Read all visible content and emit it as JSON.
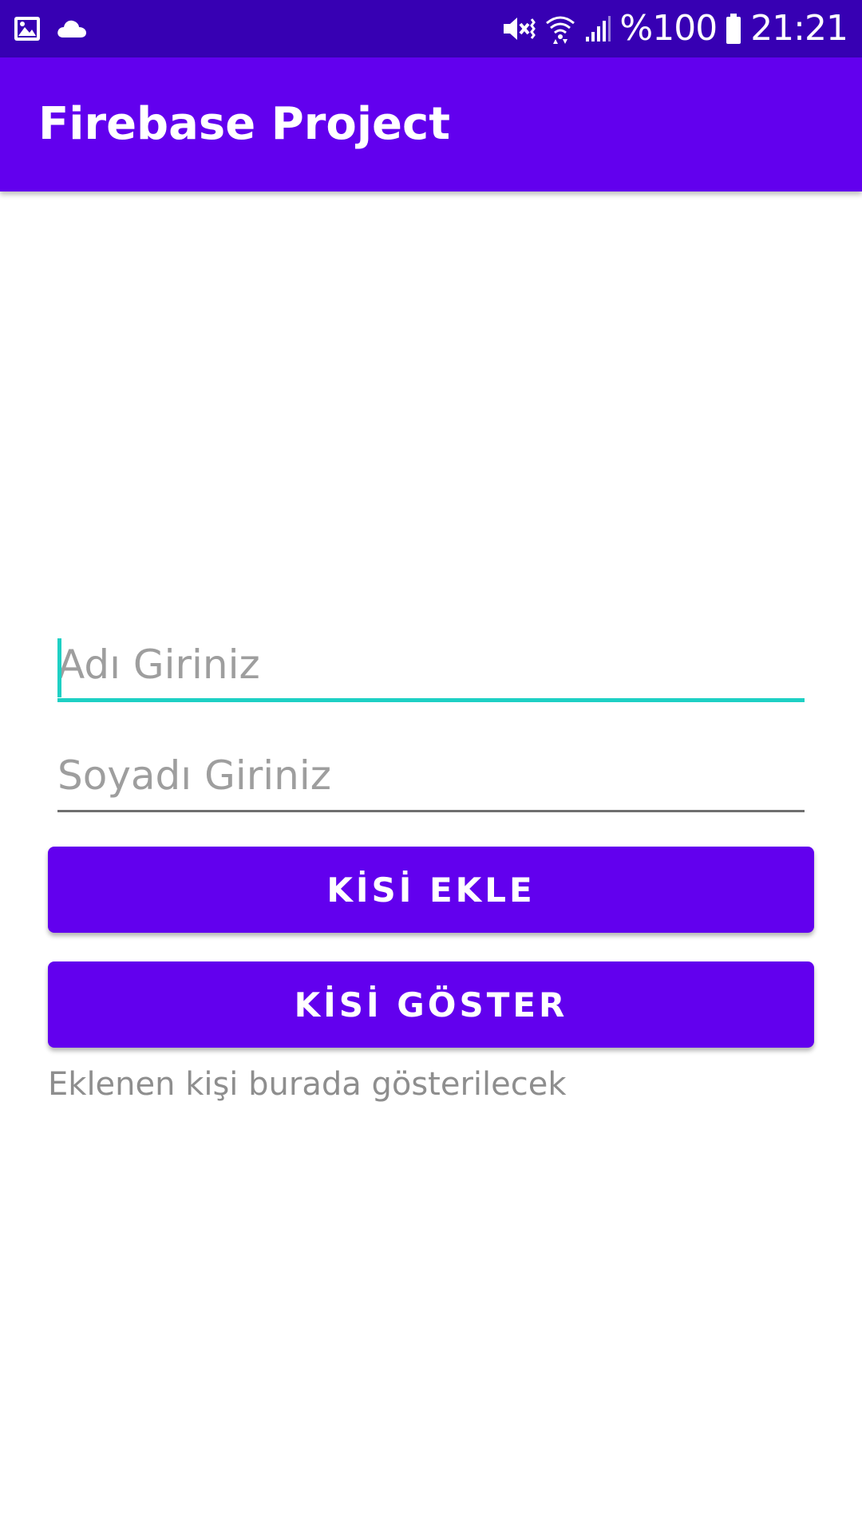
{
  "status_bar": {
    "left_icons": [
      "gallery-icon",
      "cloud-icon"
    ],
    "right_icons": [
      "mute-vibrate-icon",
      "wifi-icon",
      "signal-icon",
      "battery-icon"
    ],
    "battery_text": "%100",
    "time": "21:21"
  },
  "app_bar": {
    "title": "Firebase Project"
  },
  "form": {
    "first_name_placeholder": "Adı Giriniz",
    "last_name_placeholder": "Soyadı Giriniz",
    "add_button_label": "KİSİ EKLE",
    "show_button_label": "KİSİ GÖSTER",
    "result_text": "Eklenen kişi burada gösterilecek"
  },
  "colors": {
    "status_bar": "#3700b3",
    "primary": "#6200ee",
    "focus_accent": "#1ed0c4",
    "hint_text": "#9e9e9e"
  }
}
